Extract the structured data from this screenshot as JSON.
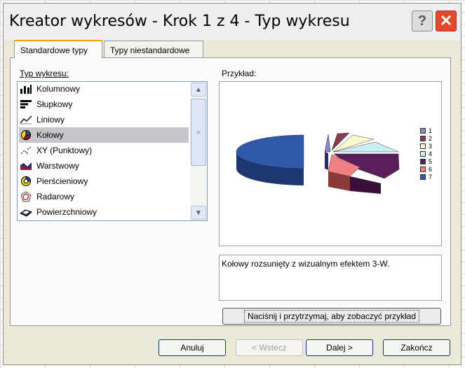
{
  "window": {
    "title": "Kreator wykresów - Krok 1 z 4 - Typ wykresu",
    "help_glyph": "?",
    "close_glyph": "✕"
  },
  "tabs": [
    {
      "label": "Standardowe typy",
      "active": true
    },
    {
      "label": "Typy niestandardowe",
      "active": false
    }
  ],
  "chart_types": {
    "label": "Typ wykresu:",
    "selected": "Kołowy",
    "items": [
      {
        "label": "Kolumnowy",
        "icon": "column-chart-icon"
      },
      {
        "label": "Słupkowy",
        "icon": "bar-chart-icon"
      },
      {
        "label": "Liniowy",
        "icon": "line-chart-icon"
      },
      {
        "label": "Kołowy",
        "icon": "pie-chart-icon"
      },
      {
        "label": "XY (Punktowy)",
        "icon": "scatter-chart-icon"
      },
      {
        "label": "Warstwowy",
        "icon": "area-chart-icon"
      },
      {
        "label": "Pierścieniowy",
        "icon": "doughnut-chart-icon"
      },
      {
        "label": "Radarowy",
        "icon": "radar-chart-icon"
      },
      {
        "label": "Powierzchniowy",
        "icon": "surface-chart-icon"
      }
    ]
  },
  "preview": {
    "label": "Przykład:",
    "legend": [
      "1",
      "2",
      "3",
      "4",
      "5",
      "6",
      "7"
    ],
    "colors": [
      "#8a8ac8",
      "#8b3a52",
      "#fafad0",
      "#c8eef2",
      "#5a1e5a",
      "#f08080",
      "#3058a8"
    ]
  },
  "description": "Kołowy rozsunięty z wizualnym efektem 3-W.",
  "buttons": {
    "sample": "Naciśnij i przytrzymaj, aby zobaczyć przykład",
    "cancel": "Anuluj",
    "back": "< Wstecz",
    "next": "Dalej >",
    "finish": "Zakończ"
  }
}
